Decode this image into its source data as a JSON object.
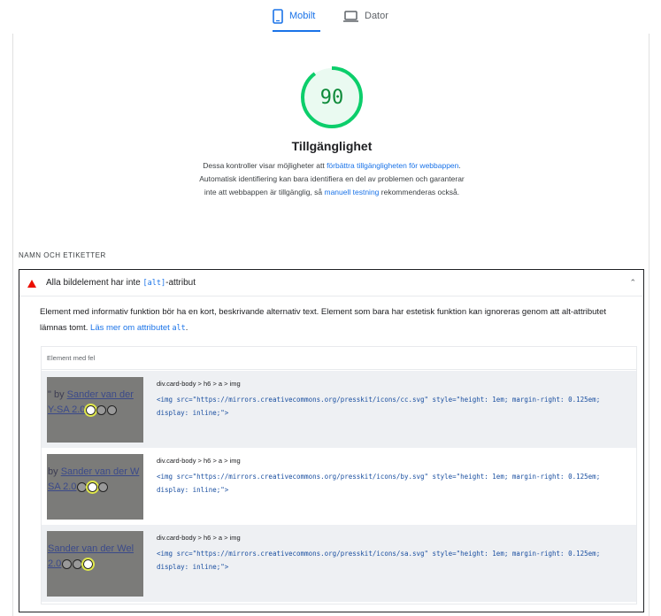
{
  "tabs": [
    {
      "label": "Mobilt",
      "icon": "smartphone-icon",
      "active": true
    },
    {
      "label": "Dator",
      "icon": "laptop-icon",
      "active": false
    }
  ],
  "category": {
    "score": "90",
    "title": "Tillgänglighet",
    "desc_part1": "Dessa kontroller visar möjligheter att ",
    "desc_link1": "förbättra tillgängligheten för webbappen",
    "desc_part2": ". Automatisk identifiering kan bara identifiera en del av problemen och garanterar inte att webbappen är tillgänglig, så ",
    "desc_link2": "manuell testning",
    "desc_part3": " rekommenderas också.",
    "gauge_color": "#0cce6b"
  },
  "section_label": "NAMN OCH ETIKETTER",
  "audit": {
    "title_before": "Alla bildelement har inte ",
    "title_code": "[alt]",
    "title_after": "-attribut",
    "status_icon": "fail-triangle-icon",
    "status_color": "#eb0f00",
    "desc_text": "Element med informativ funktion bör ha en kort, beskrivande alternativ text. Element som bara har estetisk funktion kan ignoreras genom att alt-attributet lämnas tomt. ",
    "desc_link": "Läs mer om attributet ",
    "desc_link_code": "alt",
    "desc_end": ".",
    "table_header": "Element med fel",
    "rows": [
      {
        "thumb_line1_a": "\" by ",
        "thumb_line1_b": "Sander van der",
        "thumb_line2": "Y-SA 2.0",
        "selector": "div.card-body > h6 > a > img",
        "snippet": "<img src=\"https://mirrors.creativecommons.org/presskit/icons/cc.svg\" style=\"height: 1em; margin-right: 0.125em; display: inline;\">"
      },
      {
        "thumb_line1_a": "by ",
        "thumb_line1_b": "Sander van der W",
        "thumb_line2": "SA 2.0",
        "selector": "div.card-body > h6 > a > img",
        "snippet": "<img src=\"https://mirrors.creativecommons.org/presskit/icons/by.svg\" style=\"height: 1em; margin-right: 0.125em; display: inline;\">"
      },
      {
        "thumb_line1_a": "",
        "thumb_line1_b": "Sander van der Wel",
        "thumb_line2": "2.0",
        "selector": "div.card-body > h6 > a > img",
        "snippet": "<img src=\"https://mirrors.creativecommons.org/presskit/icons/sa.svg\" style=\"height: 1em; margin-right: 0.125em; display: inline;\">"
      }
    ]
  }
}
